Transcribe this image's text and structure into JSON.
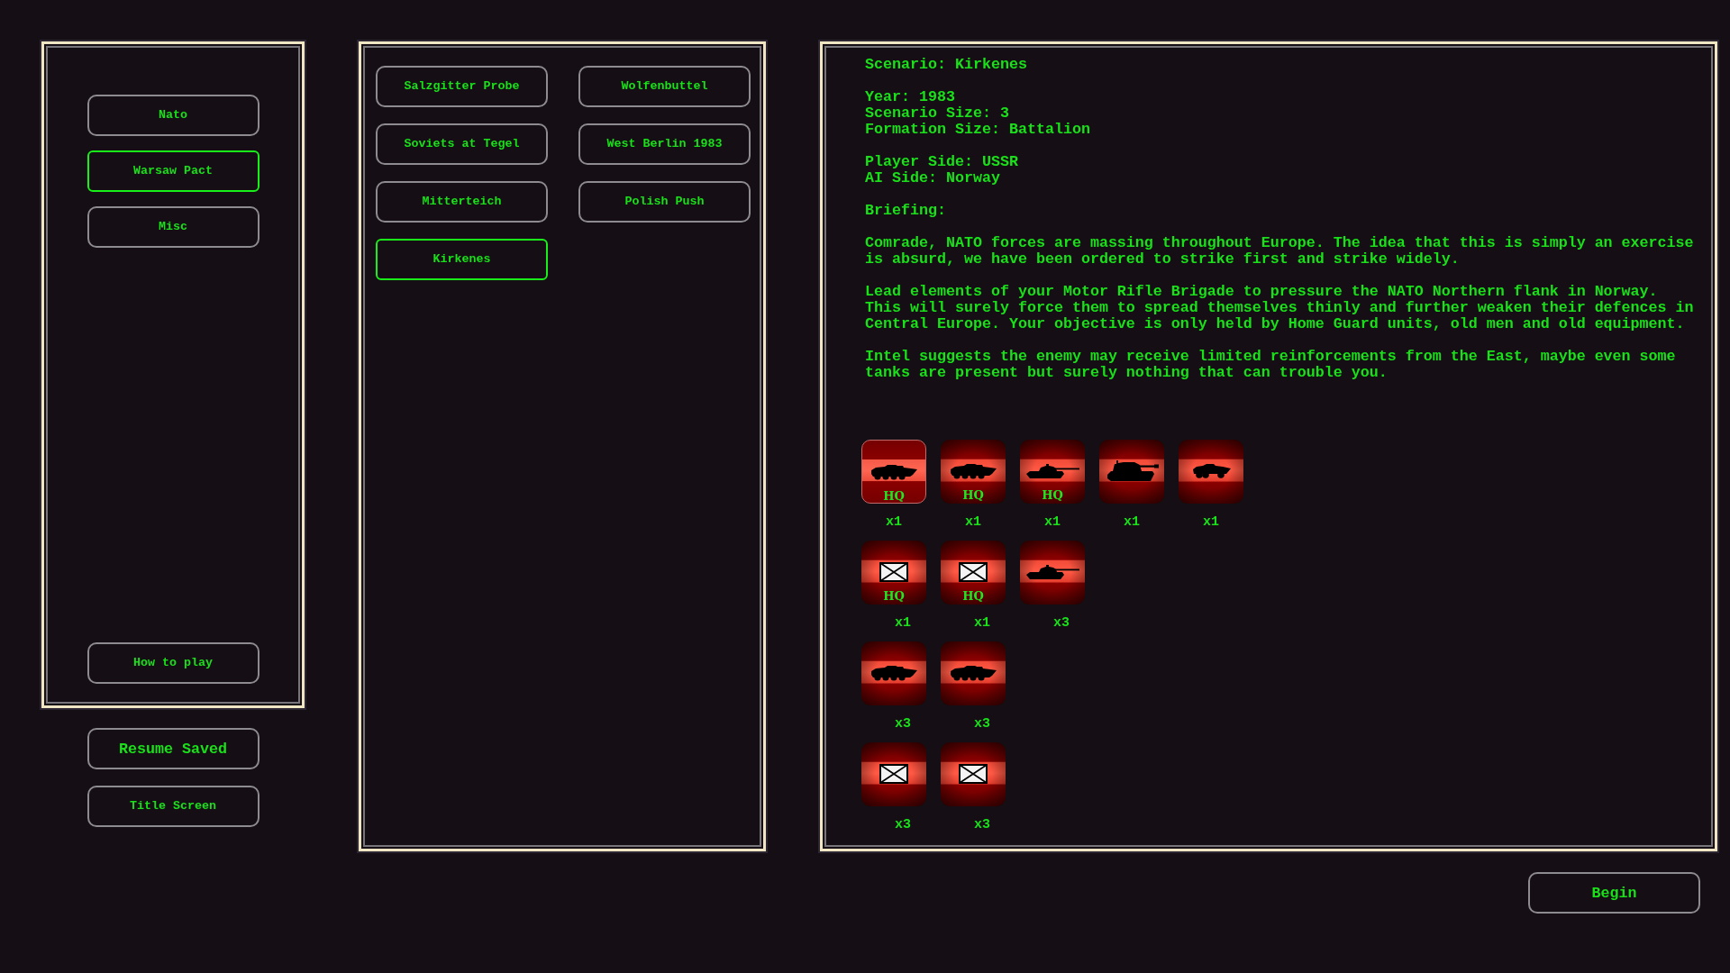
{
  "faction_panel": {
    "factions": [
      {
        "label": "Nato",
        "selected": false
      },
      {
        "label": "Warsaw Pact",
        "selected": true
      },
      {
        "label": "Misc",
        "selected": false
      }
    ],
    "help_button": "How to play"
  },
  "resume_button": "Resume Saved",
  "title_button": "Title Screen",
  "scenarios": [
    {
      "label": "Salzgitter Probe",
      "selected": false
    },
    {
      "label": "Wolfenbuttel",
      "selected": false
    },
    {
      "label": "Soviets at Tegel",
      "selected": false
    },
    {
      "label": "West Berlin 1983",
      "selected": false
    },
    {
      "label": "Mitterteich",
      "selected": false
    },
    {
      "label": "Polish Push",
      "selected": false
    },
    {
      "label": "Kirkenes",
      "selected": true
    }
  ],
  "briefing_panel": {
    "info_groups": [
      [
        "Scenario: Kirkenes"
      ],
      [
        "Year: 1983",
        "Scenario Size: 3",
        "Formation Size: Battalion"
      ],
      [
        "Player Side: USSR",
        "AI Side: Norway"
      ],
      [
        "Briefing:"
      ]
    ],
    "paragraphs": [
      "Comrade, NATO forces are massing throughout Europe. The idea that this is simply an exercise is absurd, we have been ordered to strike first and strike widely.",
      "Lead elements of your Motor Rifle Brigade to pressure the NATO Northern flank in Norway. This will surely force them to spread themselves thinly and further weaken their defences in Central Europe. Your objective is only held by Home Guard units, old men and old equipment.",
      "Intel suggests the enemy may receive limited reinforcements from the East, maybe even some tanks are present but surely nothing that can trouble you."
    ],
    "unit_rows": [
      [
        {
          "kind": "apc",
          "badge": "HQ",
          "count": "x1",
          "selected": true
        },
        {
          "kind": "apc",
          "badge": "HQ",
          "count": "x1",
          "selected": false
        },
        {
          "kind": "tank",
          "badge": "HQ",
          "count": "x1",
          "selected": false
        },
        {
          "kind": "heavy",
          "count": "x1",
          "selected": false
        },
        {
          "kind": "wheeled",
          "count": "x1",
          "selected": false
        }
      ],
      [
        {
          "kind": "infantry",
          "badge": "HQ",
          "count": "x1",
          "selected": false
        },
        {
          "kind": "infantry",
          "badge": "HQ",
          "count": "x1",
          "selected": false
        },
        {
          "kind": "tank",
          "count": "x3",
          "selected": false
        }
      ],
      [
        {
          "kind": "apc",
          "count": "x3",
          "selected": false
        },
        {
          "kind": "apc",
          "count": "x3",
          "selected": false
        }
      ],
      [
        {
          "kind": "infantry",
          "count": "x3",
          "selected": false
        },
        {
          "kind": "infantry",
          "count": "x3",
          "selected": false
        }
      ]
    ]
  },
  "begin_button": "Begin"
}
